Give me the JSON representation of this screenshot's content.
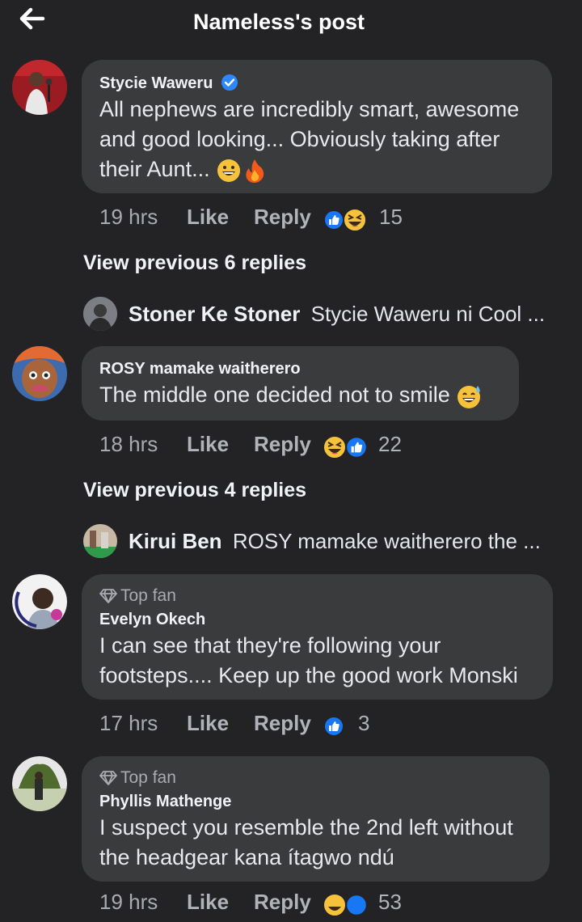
{
  "header": {
    "title": "Nameless's post",
    "back_icon": "arrow-left-icon"
  },
  "colors": {
    "background": "#232326",
    "bubble": "#3a3b3d",
    "like_blue": "#1877f2",
    "verified": "#2d88ff"
  },
  "comments": [
    {
      "author": "Stycie Waweru",
      "verified": true,
      "text": "All nephews are incredibly smart, awesome and good looking... Obviously taking after their Aunt...",
      "emojis": [
        "grinning-face",
        "fire"
      ],
      "time": "19 hrs",
      "like": "Like",
      "reply": "Reply",
      "reactions": [
        "like",
        "laugh"
      ],
      "reaction_count": "15",
      "view_previous": "View previous 6 replies",
      "latest_reply": {
        "name": "Stoner Ke Stoner",
        "text": "Stycie Waweru ni Cool ..."
      }
    },
    {
      "author": "ROSY mamake waitherero",
      "text": "The middle one decided not to smile",
      "emojis": [
        "grinning-sweat"
      ],
      "time": "18 hrs",
      "like": "Like",
      "reply": "Reply",
      "reactions": [
        "laugh",
        "like"
      ],
      "reaction_count": "22",
      "view_previous": "View previous 4 replies",
      "latest_reply": {
        "name": "Kirui Ben",
        "text": "ROSY mamake waitherero the ..."
      }
    },
    {
      "badge": "Top fan",
      "author": "Evelyn Okech",
      "text": "I can see that they're following your footsteps.... Keep up the good work Monski",
      "time": "17 hrs",
      "like": "Like",
      "reply": "Reply",
      "reactions": [
        "like"
      ],
      "reaction_count": "3"
    },
    {
      "badge": "Top fan",
      "author": "Phyllis Mathenge",
      "text": "I suspect you resemble the 2nd left without the headgear kana ítagwo ndú",
      "time": "19 hrs",
      "like": "Like",
      "reply": "Reply",
      "reactions": [
        "laugh",
        "like"
      ],
      "reaction_count": "53"
    }
  ]
}
